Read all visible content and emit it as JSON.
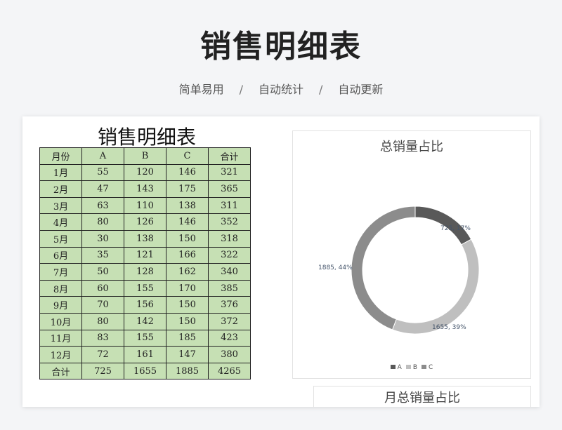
{
  "header": {
    "title": "销售明细表",
    "tags": [
      "简单易用",
      "自动统计",
      "自动更新"
    ],
    "separator": "/"
  },
  "sheet": {
    "title": "销售明细表",
    "columns": [
      "月份",
      "A",
      "B",
      "C",
      "合计"
    ],
    "rows": [
      [
        "1月",
        "55",
        "120",
        "146",
        "321"
      ],
      [
        "2月",
        "47",
        "143",
        "175",
        "365"
      ],
      [
        "3月",
        "63",
        "110",
        "138",
        "311"
      ],
      [
        "4月",
        "80",
        "126",
        "146",
        "352"
      ],
      [
        "5月",
        "30",
        "138",
        "150",
        "318"
      ],
      [
        "6月",
        "35",
        "121",
        "166",
        "322"
      ],
      [
        "7月",
        "50",
        "128",
        "162",
        "340"
      ],
      [
        "8月",
        "60",
        "155",
        "170",
        "385"
      ],
      [
        "9月",
        "70",
        "156",
        "150",
        "376"
      ],
      [
        "10月",
        "80",
        "142",
        "150",
        "372"
      ],
      [
        "11月",
        "83",
        "155",
        "185",
        "423"
      ],
      [
        "12月",
        "72",
        "161",
        "147",
        "380"
      ],
      [
        "合计",
        "725",
        "1655",
        "1885",
        "4265"
      ]
    ]
  },
  "chart_data": [
    {
      "type": "pie",
      "title": "总销量占比",
      "categories": [
        "A",
        "B",
        "C"
      ],
      "values": [
        725,
        1655,
        1885
      ],
      "labels": [
        "725, 17%",
        "1655, 39%",
        "1885, 44%"
      ],
      "colors": [
        "#595959",
        "#bfbfbf",
        "#8c8c8c"
      ],
      "legend": "bottom"
    },
    {
      "type": "pie",
      "title": "月总销量占比"
    }
  ]
}
